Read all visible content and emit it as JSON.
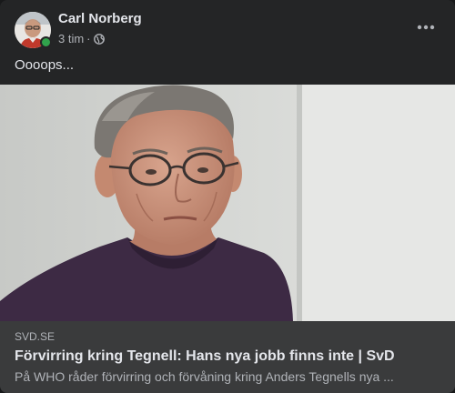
{
  "post": {
    "author": {
      "name": "Carl Norberg",
      "online": true
    },
    "time": "3 tim",
    "separator": "·",
    "audience_icon": "globe-icon",
    "text": "Oooops...",
    "more_icon": "more-horizontal-icon"
  },
  "link_preview": {
    "image_alt": "Porträtt av Anders Tegnell",
    "domain": "SVD.SE",
    "title": "Förvirring kring Tegnell: Hans nya jobb finns inte | SvD",
    "description": "På WHO råder förvirring och förvåning kring Anders Tegnells nya ..."
  },
  "colors": {
    "card_bg": "#242526",
    "footer_bg": "#3a3b3c",
    "primary_text": "#e4e6eb",
    "secondary_text": "#b0b3b8",
    "online_green": "#31a24c"
  }
}
